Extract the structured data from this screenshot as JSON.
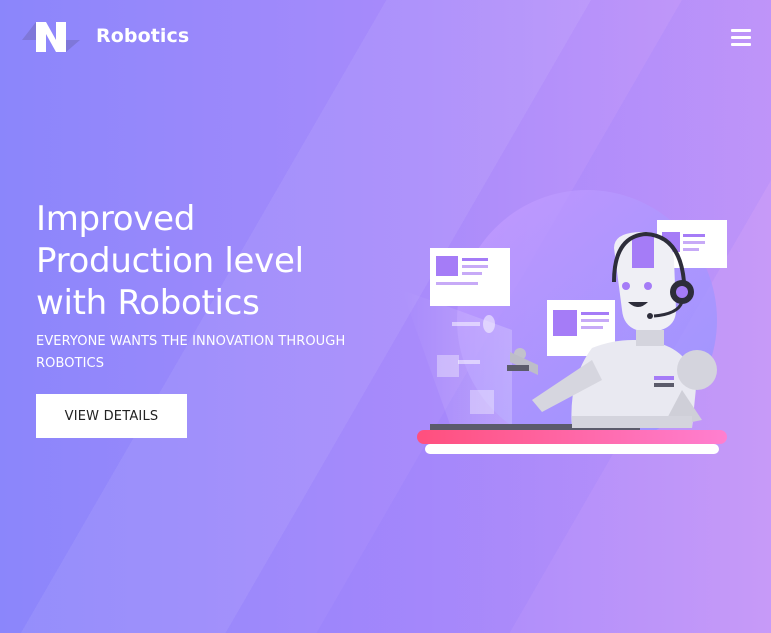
{
  "header": {
    "brand": "Robotics",
    "menu_icon": "hamburger-menu-icon"
  },
  "hero": {
    "title_lines": [
      "Improved",
      "Production level",
      "with Robotics"
    ],
    "subtitle": "EVERYONE WANTS THE INNOVATION THROUGH ROBOTICS",
    "cta_label": "VIEW DETAILS"
  },
  "colors": {
    "gradient_start": "#8b86fb",
    "gradient_end": "#c79af8",
    "desk_pink": "#ff4f8b",
    "accent_purple": "#a57cf7"
  }
}
